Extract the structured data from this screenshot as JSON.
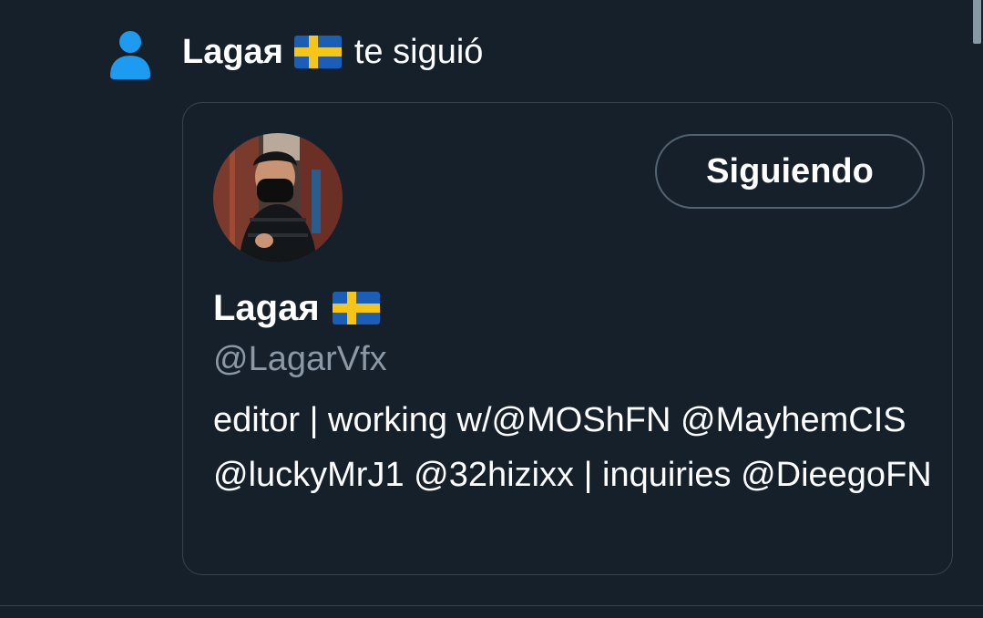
{
  "notification": {
    "icon": "person-icon",
    "follower_name": "Lagaя",
    "flag": "sweden-flag",
    "action_text": "te siguió"
  },
  "user_card": {
    "follow_button_label": "Siguiendo",
    "name": "Lagaя",
    "flag": "sweden-flag",
    "handle": "@LagarVfx",
    "bio": "editor | working w/@MOShFN @MayhemCIS @luckyMrJ1 @32hizixx | inquiries @DieegoFN"
  },
  "colors": {
    "background": "#15202b",
    "accent_blue": "#1d9bf0",
    "secondary_text": "#8b98a5",
    "border": "#38444d",
    "flag_blue": "#1a5eb8",
    "flag_yellow": "#f5c518"
  }
}
